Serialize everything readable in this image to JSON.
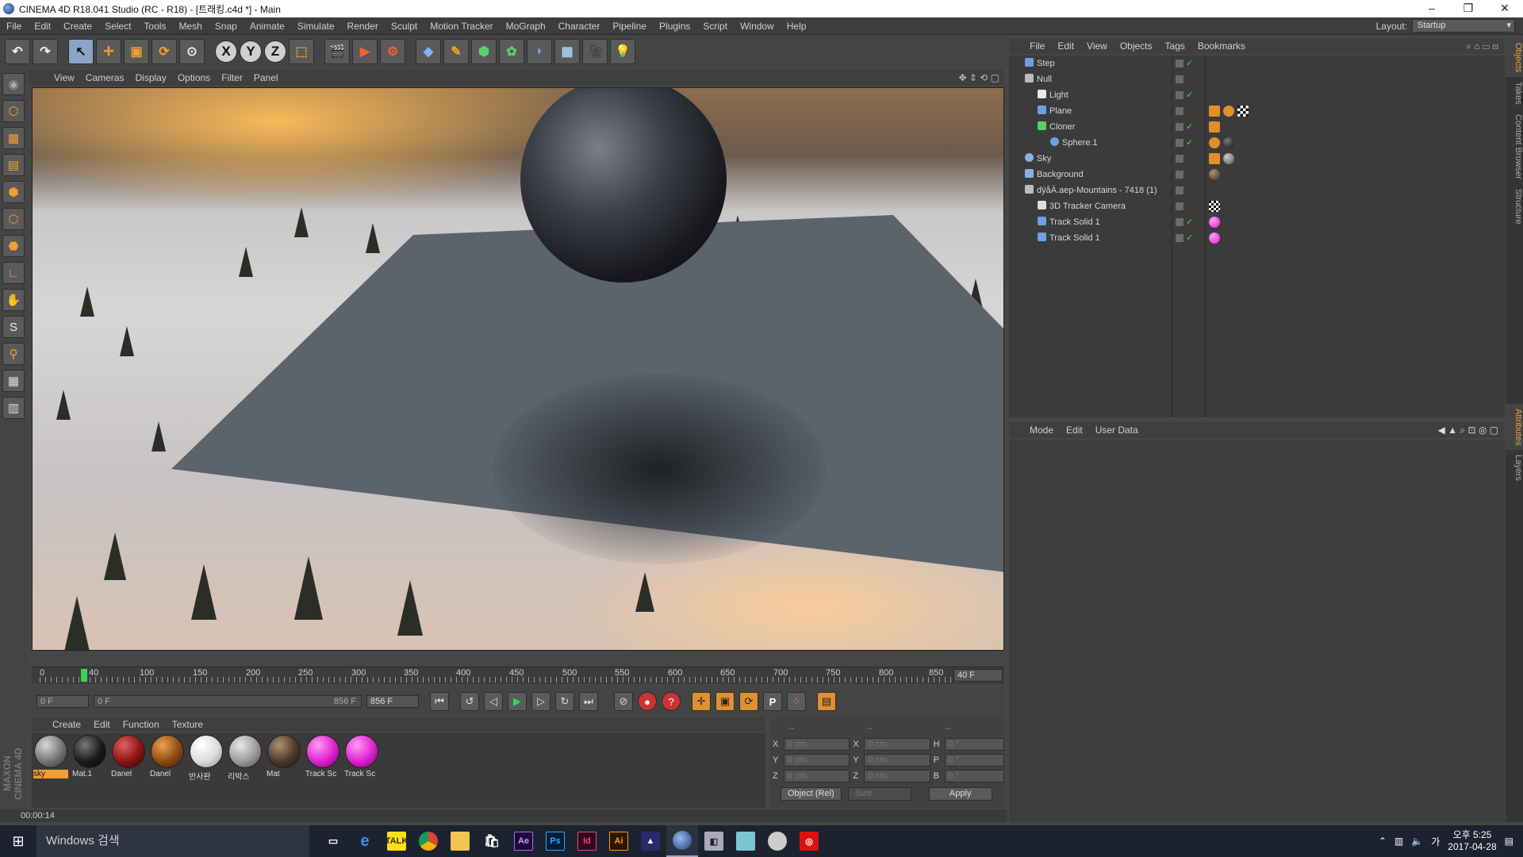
{
  "window": {
    "title": "CINEMA 4D R18.041 Studio (RC - R18) - [트래킹.c4d *] - Main"
  },
  "menubar": [
    "File",
    "Edit",
    "Create",
    "Select",
    "Tools",
    "Mesh",
    "Snap",
    "Animate",
    "Simulate",
    "Render",
    "Sculpt",
    "Motion Tracker",
    "MoGraph",
    "Character",
    "Pipeline",
    "Plugins",
    "Script",
    "Window",
    "Help"
  ],
  "layout": {
    "label": "Layout:",
    "value": "Startup"
  },
  "viewport_menu": [
    "View",
    "Cameras",
    "Display",
    "Options",
    "Filter",
    "Panel"
  ],
  "timeline": {
    "ticks": [
      "0",
      "40",
      "100",
      "150",
      "200",
      "250",
      "300",
      "350",
      "400",
      "450",
      "500",
      "550",
      "600",
      "650",
      "700",
      "750",
      "800",
      "850"
    ],
    "end_frame": "40 F",
    "current_frame": "0 F",
    "range_start": "0 F",
    "range_end": "856 F",
    "max_frame": "856 F",
    "current_value": 40,
    "max_value": 856
  },
  "materials_menu": [
    "Create",
    "Edit",
    "Function",
    "Texture"
  ],
  "materials": [
    {
      "name": "sky",
      "color": "#7a7a7a"
    },
    {
      "name": "Mat.1",
      "color": "#1a1a1a"
    },
    {
      "name": "Danel",
      "color": "#8b1414"
    },
    {
      "name": "Danel",
      "color": "#8b4a10"
    },
    {
      "name": "반사판",
      "color": "#e6e6e6"
    },
    {
      "name": "리박스",
      "color": "#a6a6a6"
    },
    {
      "name": "Mat",
      "color": "#5a4a3a"
    },
    {
      "name": "Track Sc",
      "color": "#e020d0"
    },
    {
      "name": "Track Sc",
      "color": "#e020d0"
    }
  ],
  "coordinates": {
    "headers": [
      "--",
      "--",
      "--"
    ],
    "rows": [
      {
        "a": "X",
        "v1": "0 cm",
        "b": "X",
        "v2": "0 cm",
        "c": "H",
        "v3": "0 °"
      },
      {
        "a": "Y",
        "v1": "0 cm",
        "b": "Y",
        "v2": "0 cm",
        "c": "P",
        "v3": "0 °"
      },
      {
        "a": "Z",
        "v1": "0 cm",
        "b": "Z",
        "v2": "0 cm",
        "c": "B",
        "v3": "0 °"
      }
    ],
    "mode": "Object (Rel)",
    "size": "Size",
    "apply": "Apply"
  },
  "status_time": "00:00:14",
  "maxon_logo": "MAXON CINEMA 4D",
  "om_menu": [
    "File",
    "Edit",
    "View",
    "Objects",
    "Tags",
    "Bookmarks"
  ],
  "objects": [
    {
      "name": "Step",
      "depth": 0,
      "icon": "#6da0e0"
    },
    {
      "name": "Null",
      "depth": 0,
      "icon": "#bbbbbb"
    },
    {
      "name": "Light",
      "depth": 1,
      "icon": "#e8e8e8"
    },
    {
      "name": "Plane",
      "depth": 1,
      "icon": "#6da0e0"
    },
    {
      "name": "Cloner",
      "depth": 1,
      "icon": "#5ad06a"
    },
    {
      "name": "Sphere.1",
      "depth": 2,
      "icon": "#6da0e0"
    },
    {
      "name": "Sky",
      "depth": 0,
      "icon": "#8ab0e0"
    },
    {
      "name": "Background",
      "depth": 0,
      "icon": "#8ab0e0"
    },
    {
      "name": "dÿåÄ.aep-Mountains - 7418 (1)",
      "depth": 0,
      "icon": "#bbbbbb"
    },
    {
      "name": "3D Tracker Camera",
      "depth": 1,
      "icon": "#dddddd"
    },
    {
      "name": "Track Solid 1",
      "depth": 1,
      "icon": "#6da0e0"
    },
    {
      "name": "Track Solid 1",
      "depth": 1,
      "icon": "#6da0e0"
    }
  ],
  "attr_menu": [
    "Mode",
    "Edit",
    "User Data"
  ],
  "right_tabs": [
    "Objects",
    "Takes",
    "Content Browser",
    "Structure",
    "Attributes",
    "Layers"
  ],
  "taskbar": {
    "search": "Windows 검색",
    "apps": [
      "Ae",
      "Ps",
      "Id",
      "Ai"
    ],
    "time": "오후 5:25",
    "date": "2017-04-28",
    "ime": "가"
  }
}
